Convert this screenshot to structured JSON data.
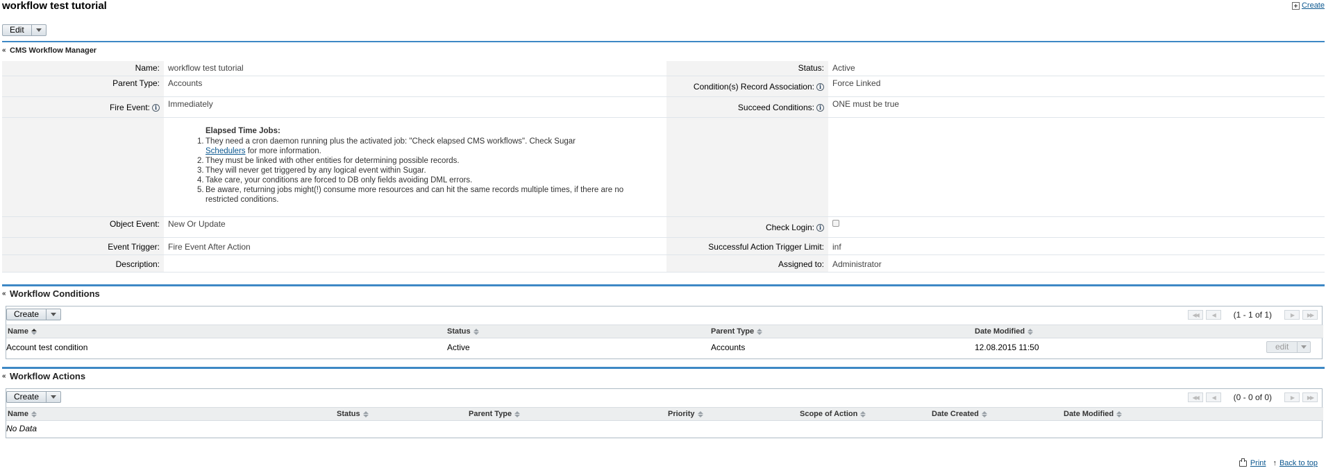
{
  "header": {
    "title": "workflow test tutorial",
    "create_label": "Create",
    "edit_label": "Edit"
  },
  "panel": {
    "title": "CMS Workflow Manager"
  },
  "fields": {
    "name_label": "Name:",
    "name_value": "workflow test tutorial",
    "status_label": "Status:",
    "status_value": "Active",
    "parent_type_label": "Parent Type:",
    "parent_type_value": "Accounts",
    "condition_assoc_label": "Condition(s) Record Association:",
    "condition_assoc_value": "Force Linked",
    "fire_event_label": "Fire Event:",
    "fire_event_value": "Immediately",
    "succeed_conditions_label": "Succeed Conditions:",
    "succeed_conditions_value": "ONE must be true",
    "object_event_label": "Object Event:",
    "object_event_value": "New Or Update",
    "check_login_label": "Check Login:",
    "event_trigger_label": "Event Trigger:",
    "event_trigger_value": "Fire Event After Action",
    "success_limit_label": "Successful Action Trigger Limit:",
    "success_limit_value": "inf",
    "description_label": "Description:",
    "description_value": "",
    "assigned_label": "Assigned to:",
    "assigned_value": "Administrator"
  },
  "notes": {
    "title": "Elapsed Time Jobs:",
    "item1_num": "1.",
    "item1_pre": "They need a cron daemon running plus the activated job: \"Check elapsed CMS workflows\". Check Sugar",
    "item1_link": "Schedulers",
    "item1_post": " for more information.",
    "item2_num": "2.",
    "item2": "They must be linked with other entities for determining possible records.",
    "item3_num": "3.",
    "item3": "They will never get triggered by any logical event within Sugar.",
    "item4_num": "4.",
    "item4": "Take care, your conditions are forced to DB only fields avoiding DML errors.",
    "item5_num": "5.",
    "item5": "Be aware, returning jobs might(!) consume more resources and can hit the same records multiple times, if there are no restricted conditions."
  },
  "conditions": {
    "title": "Workflow Conditions",
    "create_label": "Create",
    "pager_text": "(1 - 1 of 1)",
    "columns": [
      "Name",
      "Status",
      "Parent Type",
      "Date Modified"
    ],
    "rows": [
      {
        "name": "Account test condition",
        "status": "Active",
        "parent_type": "Accounts",
        "date_modified": "12.08.2015 11:50",
        "action_label": "edit"
      }
    ]
  },
  "actions": {
    "title": "Workflow Actions",
    "create_label": "Create",
    "pager_text": "(0 - 0 of 0)",
    "columns": [
      "Name",
      "Status",
      "Parent Type",
      "Priority",
      "Scope of Action",
      "Date Created",
      "Date Modified"
    ],
    "empty_text": "No Data"
  },
  "footer": {
    "print_label": "Print",
    "back_to_top_label": "Back to top"
  },
  "colors": {
    "accent_line": "#3d88c5",
    "link": "#0b578f",
    "label_bg": "#f3f3f3"
  }
}
